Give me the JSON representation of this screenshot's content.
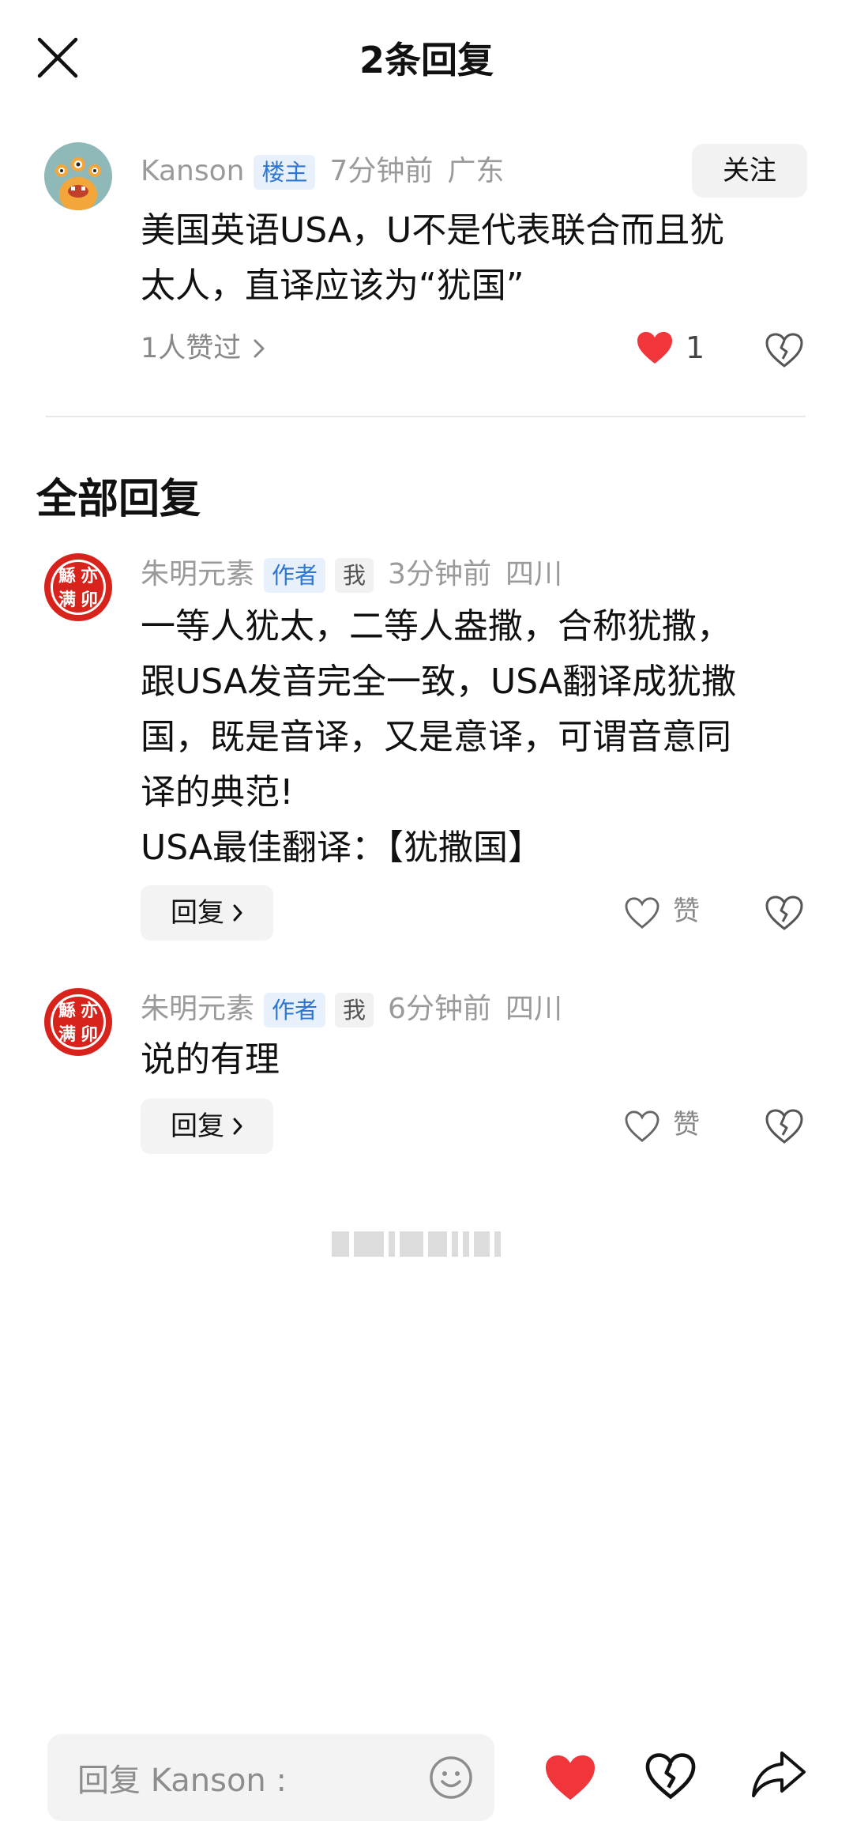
{
  "header": {
    "title": "2条回复"
  },
  "main_comment": {
    "username": "Kanson",
    "badge": "楼主",
    "time": "7分钟前",
    "location": "广东",
    "follow_label": "关注",
    "text_lines": [
      "美国英语USA，U不是代表联合而且犹",
      "太人，直译应该为“犹国”"
    ],
    "likes_text": "1人赞过",
    "like_count": "1",
    "liked": true
  },
  "section": {
    "title": "全部回复"
  },
  "replies": [
    {
      "username": "朱明元素",
      "badge_author": "作者",
      "badge_me": "我",
      "time": "3分钟前",
      "location": "四川",
      "text_lines": [
        "一等人犹太，二等人盎撒，合称犹撒，",
        "跟USA发音完全一致，USA翻译成犹撒",
        "国，既是音译，又是意译，可谓音意同",
        "译的典范!",
        "USA最佳翻译：【犹撒国】"
      ],
      "reply_label": "回复",
      "like_label": "赞"
    },
    {
      "username": "朱明元素",
      "badge_author": "作者",
      "badge_me": "我",
      "time": "6分钟前",
      "location": "四川",
      "text_lines": [
        "说的有理"
      ],
      "reply_label": "回复",
      "like_label": "赞"
    }
  ],
  "seal_chars": [
    "鯀",
    "亦",
    "满",
    "卯"
  ],
  "bottom_bar": {
    "input_placeholder": "回复 Kanson :"
  },
  "colors": {
    "like_red": "#f0353b",
    "tag_blue": "#2f76d2",
    "seal_red": "#d8231c"
  },
  "icons": [
    "close-icon",
    "heart-icon",
    "broken-heart-icon",
    "chevron-right-icon",
    "emoji-icon",
    "share-icon"
  ]
}
